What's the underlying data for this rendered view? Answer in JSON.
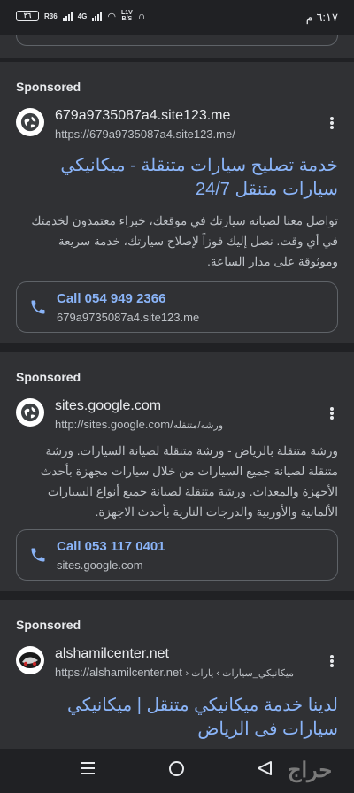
{
  "status_bar": {
    "time": "٦:١٧ م",
    "battery": "٣٦",
    "signal_1": "R36",
    "signal_2": "4G",
    "speed_top": "L1V",
    "speed_bottom": "B/S"
  },
  "ads": [
    {
      "sponsored_label": "Sponsored",
      "domain": "679a9735087a4.site123.me",
      "url": "https://679a9735087a4.site123.me/",
      "title": "خدمة تصليح سيارات متنقلة - ميكانيكي سيارات متنقل 24/7",
      "description": "تواصل معنا لصيانة سيارتك في موقعك، خبراء معتمدون لخدمتك في أي وقت. نصل إليك فوزاً لإصلاح سيارتك، خدمة سريعة وموثوقة على مدار الساعة.",
      "call_label": "Call 054 949 2366",
      "call_sub": "679a9735087a4.site123.me"
    },
    {
      "sponsored_label": "Sponsored",
      "domain": "sites.google.com",
      "url_prefix": "http://sites.google.com/",
      "url_suffix": "ورشه/متنقله",
      "description": "ورشة متنقلة بالرياض - ورشة متنقلة لصيانة السيارات. ورشة متنقلة لصيانة جميع السيارات من خلال سيارات مجهزة بأحدث الأجهزة والمعدات. ورشة متنقلة لصيانة جميع أنواع السيارات الألمانية والأوربية والدرجات النارية بأحدث الاجهزة.",
      "call_label": "Call 053 117 0401",
      "call_sub": "sites.google.com"
    },
    {
      "sponsored_label": "Sponsored",
      "domain": "alshamilcenter.net",
      "url_prefix": "https://alshamilcenter.net",
      "url_suffix": "› ميكانيكي_سيارات › يارات",
      "title": "لدينا خدمة ميكانيكي متنقل | ميكانيكي سيارات فى الرياض"
    }
  ],
  "nav_bar": {
    "watermark": "حراج"
  },
  "colors": {
    "background": "#202124",
    "card": "#303134",
    "link": "#8ab4f8",
    "text": "#e8eaed",
    "secondary_text": "#bdc1c6"
  }
}
